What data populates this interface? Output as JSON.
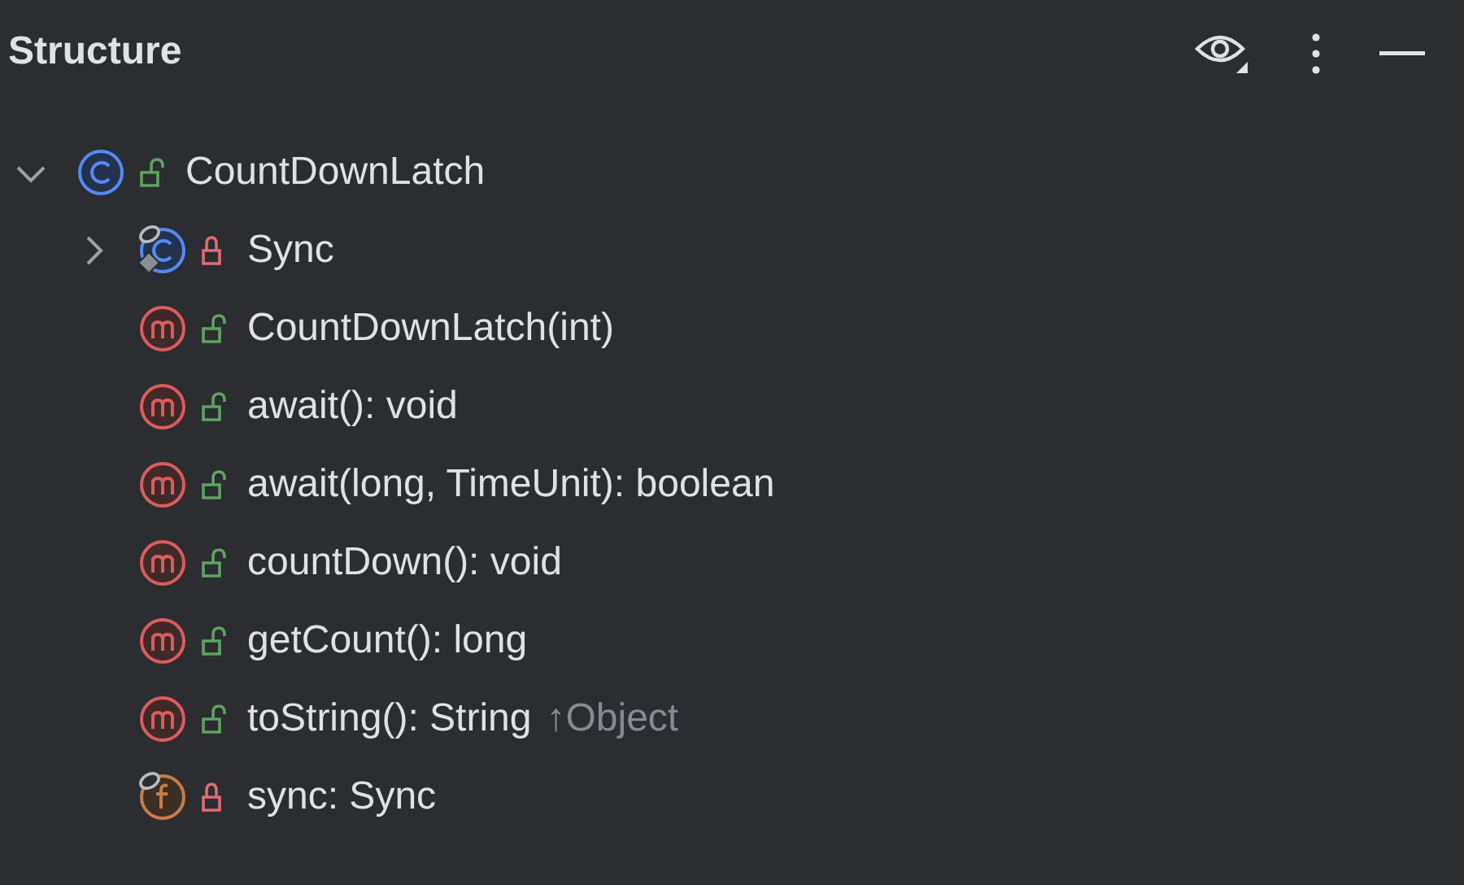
{
  "panel": {
    "title": "Structure"
  },
  "tree": [
    {
      "kind": "class",
      "private": false,
      "final": false,
      "static": false,
      "label": "CountDownLatch",
      "expanded": true,
      "children": [
        {
          "kind": "class",
          "private": true,
          "final": true,
          "static": true,
          "label": "Sync",
          "expanded": false
        },
        {
          "kind": "method",
          "private": false,
          "final": false,
          "static": false,
          "label": "CountDownLatch(int)"
        },
        {
          "kind": "method",
          "private": false,
          "final": false,
          "static": false,
          "label": "await(): void"
        },
        {
          "kind": "method",
          "private": false,
          "final": false,
          "static": false,
          "label": "await(long, TimeUnit): boolean"
        },
        {
          "kind": "method",
          "private": false,
          "final": false,
          "static": false,
          "label": "countDown(): void"
        },
        {
          "kind": "method",
          "private": false,
          "final": false,
          "static": false,
          "label": "getCount(): long"
        },
        {
          "kind": "method",
          "private": false,
          "final": false,
          "static": false,
          "label": "toString(): String",
          "origin": "↑Object"
        },
        {
          "kind": "field",
          "private": true,
          "final": true,
          "static": false,
          "label": "sync: Sync"
        }
      ]
    }
  ]
}
